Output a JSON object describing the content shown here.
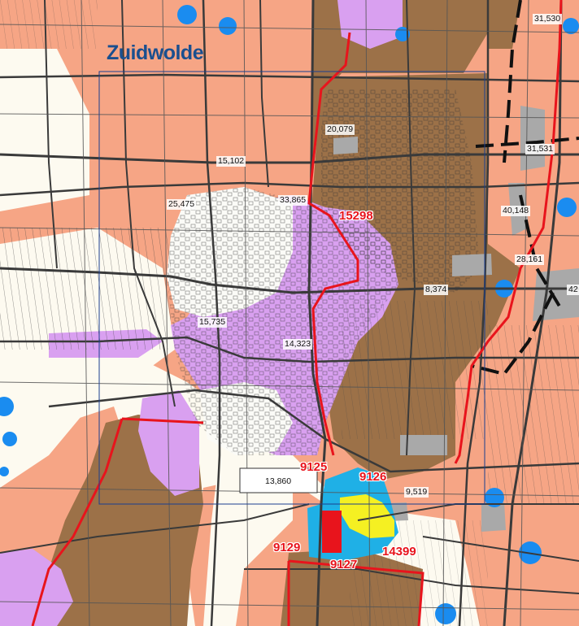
{
  "map": {
    "place_name": "Zuidwolde",
    "labels": [
      {
        "id": "31530",
        "text": "31,530"
      },
      {
        "id": "20079",
        "text": "20,079"
      },
      {
        "id": "31531",
        "text": "31,531"
      },
      {
        "id": "15102",
        "text": "15,102"
      },
      {
        "id": "25475",
        "text": "25,475"
      },
      {
        "id": "33865",
        "text": "33,865"
      },
      {
        "id": "40148",
        "text": "40,148"
      },
      {
        "id": "28161",
        "text": "28,161"
      },
      {
        "id": "8374",
        "text": "8,374"
      },
      {
        "id": "42",
        "text": "42"
      },
      {
        "id": "15735",
        "text": "15,735"
      },
      {
        "id": "14323",
        "text": "14,323"
      },
      {
        "id": "13860",
        "text": "13,860"
      },
      {
        "id": "9519",
        "text": "9,519"
      }
    ],
    "parcels": [
      {
        "id": "15298",
        "text": "15298"
      },
      {
        "id": "9125",
        "text": "9125"
      },
      {
        "id": "9126",
        "text": "9126"
      },
      {
        "id": "9129",
        "text": "9129"
      },
      {
        "id": "9127",
        "text": "9127"
      },
      {
        "id": "14399",
        "text": "14399"
      }
    ],
    "colors": {
      "background": "#fdfaf0",
      "salmon_zone": "#f6a585",
      "brown_zone": "#9c7148",
      "lilac_zone": "#d9a0f0",
      "blue_zone": "#1fb0e6",
      "yellow_zone": "#f5f022",
      "grey_zone": "#a9a9a9",
      "blue_dot": "#1a8cf0",
      "parcel_outline": "#e8141c",
      "roads": "#3a3a3a",
      "frame": "#1a3f8f"
    }
  }
}
